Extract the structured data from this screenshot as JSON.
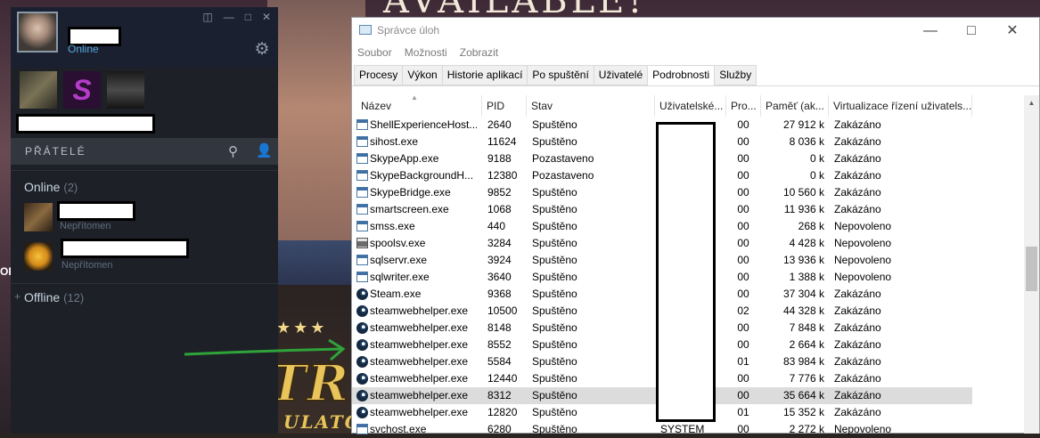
{
  "background": {
    "available_text": "AVAILABLE!",
    "side_text": "OP",
    "game_logo_line1": "TRU",
    "game_logo_line2": "ULATORS",
    "game_logo_stars": "★★★"
  },
  "steam": {
    "self_status": "Online",
    "friends_header": "PŘÁTELÉ",
    "groups": {
      "online": {
        "label": "Online",
        "count": "(2)"
      },
      "offline": {
        "label": "Offline",
        "count": "(12)",
        "expander": "+"
      }
    },
    "friends": [
      {
        "status": "Nepřítomen"
      },
      {
        "status": "Nepřítomen"
      }
    ],
    "colors": {
      "accent": "#57a7d9",
      "panel": "#1d2027",
      "header": "#32363f"
    }
  },
  "taskmanager": {
    "title": "Správce úloh",
    "menu": [
      "Soubor",
      "Možnosti",
      "Zobrazit"
    ],
    "tabs": [
      "Procesy",
      "Výkon",
      "Historie aplikací",
      "Po spuštění",
      "Uživatelé",
      "Podrobnosti",
      "Služby"
    ],
    "active_tab": "Podrobnosti",
    "columns": [
      "Název",
      "PID",
      "Stav",
      "Uživatelské...",
      "Pro...",
      "Paměť (ak...",
      "Virtualizace řízení uživatels..."
    ],
    "rows": [
      {
        "icon": "window-icon",
        "name": "ShellExperienceHost....",
        "pid": "2640",
        "stav": "Spuštěno",
        "user": "",
        "pro": "00",
        "mem": "27 912 k",
        "virt": "Zakázáno"
      },
      {
        "icon": "window-icon",
        "name": "sihost.exe",
        "pid": "11624",
        "stav": "Spuštěno",
        "user": "",
        "pro": "00",
        "mem": "8 036 k",
        "virt": "Zakázáno"
      },
      {
        "icon": "window-icon",
        "name": "SkypeApp.exe",
        "pid": "9188",
        "stav": "Pozastaveno",
        "user": "",
        "pro": "00",
        "mem": "0 k",
        "virt": "Zakázáno"
      },
      {
        "icon": "window-icon",
        "name": "SkypeBackgroundH...",
        "pid": "12380",
        "stav": "Pozastaveno",
        "user": "",
        "pro": "00",
        "mem": "0 k",
        "virt": "Zakázáno"
      },
      {
        "icon": "window-icon",
        "name": "SkypeBridge.exe",
        "pid": "9852",
        "stav": "Spuštěno",
        "user": "",
        "pro": "00",
        "mem": "10 560 k",
        "virt": "Zakázáno"
      },
      {
        "icon": "window-icon",
        "name": "smartscreen.exe",
        "pid": "1068",
        "stav": "Spuštěno",
        "user": "",
        "pro": "00",
        "mem": "11 936 k",
        "virt": "Zakázáno"
      },
      {
        "icon": "window-icon",
        "name": "smss.exe",
        "pid": "440",
        "stav": "Spuštěno",
        "user": "",
        "pro": "00",
        "mem": "268 k",
        "virt": "Nepovoleno"
      },
      {
        "icon": "printer-icon",
        "name": "spoolsv.exe",
        "pid": "3284",
        "stav": "Spuštěno",
        "user": "",
        "pro": "00",
        "mem": "4 428 k",
        "virt": "Nepovoleno"
      },
      {
        "icon": "window-icon",
        "name": "sqlservr.exe",
        "pid": "3924",
        "stav": "Spuštěno",
        "user": "",
        "pro": "00",
        "mem": "13 936 k",
        "virt": "Nepovoleno"
      },
      {
        "icon": "window-icon",
        "name": "sqlwriter.exe",
        "pid": "3640",
        "stav": "Spuštěno",
        "user": "",
        "pro": "00",
        "mem": "1 388 k",
        "virt": "Nepovoleno"
      },
      {
        "icon": "steam-icon",
        "name": "Steam.exe",
        "pid": "9368",
        "stav": "Spuštěno",
        "user": "",
        "pro": "00",
        "mem": "37 304 k",
        "virt": "Zakázáno"
      },
      {
        "icon": "steam-icon",
        "name": "steamwebhelper.exe",
        "pid": "10500",
        "stav": "Spuštěno",
        "user": "",
        "pro": "02",
        "mem": "44 328 k",
        "virt": "Zakázáno"
      },
      {
        "icon": "steam-icon",
        "name": "steamwebhelper.exe",
        "pid": "8148",
        "stav": "Spuštěno",
        "user": "",
        "pro": "00",
        "mem": "7 848 k",
        "virt": "Zakázáno"
      },
      {
        "icon": "steam-icon",
        "name": "steamwebhelper.exe",
        "pid": "8552",
        "stav": "Spuštěno",
        "user": "",
        "pro": "00",
        "mem": "2 664 k",
        "virt": "Zakázáno"
      },
      {
        "icon": "steam-icon",
        "name": "steamwebhelper.exe",
        "pid": "5584",
        "stav": "Spuštěno",
        "user": "",
        "pro": "01",
        "mem": "83 984 k",
        "virt": "Zakázáno"
      },
      {
        "icon": "steam-icon",
        "name": "steamwebhelper.exe",
        "pid": "12440",
        "stav": "Spuštěno",
        "user": "",
        "pro": "00",
        "mem": "7 776 k",
        "virt": "Zakázáno"
      },
      {
        "icon": "steam-icon",
        "name": "steamwebhelper.exe",
        "pid": "8312",
        "stav": "Spuštěno",
        "user": "",
        "pro": "00",
        "mem": "35 664 k",
        "virt": "Zakázáno",
        "selected": true
      },
      {
        "icon": "steam-icon",
        "name": "steamwebhelper.exe",
        "pid": "12820",
        "stav": "Spuštěno",
        "user": "",
        "pro": "01",
        "mem": "15 352 k",
        "virt": "Zakázáno"
      },
      {
        "icon": "window-icon",
        "name": "svchost.exe",
        "pid": "6280",
        "stav": "Spuštěno",
        "user": "SYSTEM",
        "pro": "00",
        "mem": "2 272 k",
        "virt": "Nepovoleno"
      }
    ]
  }
}
